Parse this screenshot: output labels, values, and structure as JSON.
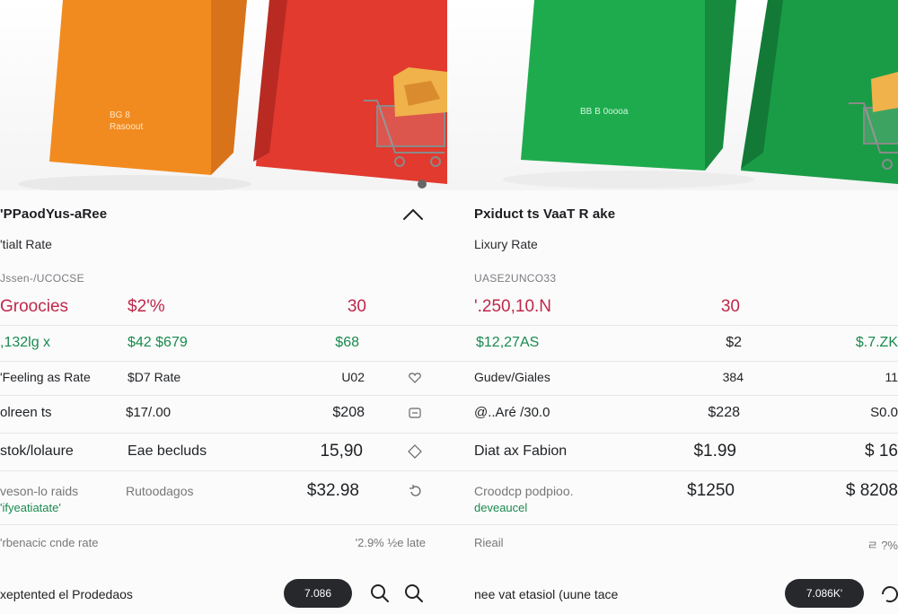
{
  "colors": {
    "red_text": "#c0274a",
    "green_text": "#1a8a4f",
    "pill_bg": "#26282b",
    "bag_orange": "#f28b1f",
    "bag_red": "#e23a2f",
    "bag_green": "#1eab4e"
  },
  "left": {
    "title": "'PPaodYus-aRee",
    "subtitle": "'tialt Rate",
    "section_label": "Jssen-/UCOCSE",
    "bag_print": "BG 8 Rasoout",
    "trend_icon": "chevron-up-icon",
    "rows": [
      {
        "name": "Groocies",
        "mid": "$2'%",
        "value": "30"
      },
      {
        "name": ",132lg x",
        "mid": "$42 $679",
        "value": "$68"
      },
      {
        "name": "'Feeling as Rate",
        "mid": "$D7 Rate",
        "value": "U02",
        "icon": "heart-icon"
      },
      {
        "name": "olreen ts",
        "mid": "$17/.00",
        "value": "$208",
        "icon": "minus-box-icon"
      },
      {
        "name": "stok/lolaure",
        "mid": "Eae becluds",
        "value": "15,90",
        "icon": "diamond-icon"
      },
      {
        "name": "veson-lo raids",
        "sub": "'ifyeatiatate'",
        "mid": "Rutoodagos",
        "value": "$32.98",
        "icon": "refresh-icon"
      }
    ],
    "footer_row": {
      "left": "'rbenacic cnde rate",
      "right": "'2.9%  ½e late"
    },
    "footer": {
      "text": "xeptented el Prodedaos",
      "pill": "7.086",
      "search_icon_1": "search-icon",
      "search_icon_2": "search-icon"
    }
  },
  "right": {
    "title": "Pxiduct ts VaaT R ake",
    "subtitle": "Lixury Rate",
    "section_label": "UASE2UNCO33",
    "bag_print": "BB B 0oooa",
    "rows": [
      {
        "name": "'.250,10.N",
        "value": "30",
        "right": ""
      },
      {
        "name": "$12,27AS",
        "value": "$2",
        "right": "$.7.ZK"
      },
      {
        "name": "Gudev/Giales",
        "value": "384",
        "right": "11"
      },
      {
        "name": "@..Aré /30.0",
        "value": "$228",
        "right": "S0.0"
      },
      {
        "name": "Diat ax Fabion",
        "value": "$1.99",
        "right": "$ 16"
      },
      {
        "name": "Croodcp podpioo.",
        "sub": "deveaucel",
        "value": "$1250",
        "right": "$ 8208"
      }
    ],
    "footer_row": {
      "left": "Rieail",
      "right": "ㄹ ?%"
    },
    "footer": {
      "text": "nee vat etasiol (uune tace",
      "pill": "7.086K'",
      "icon": "refresh-icon"
    }
  }
}
